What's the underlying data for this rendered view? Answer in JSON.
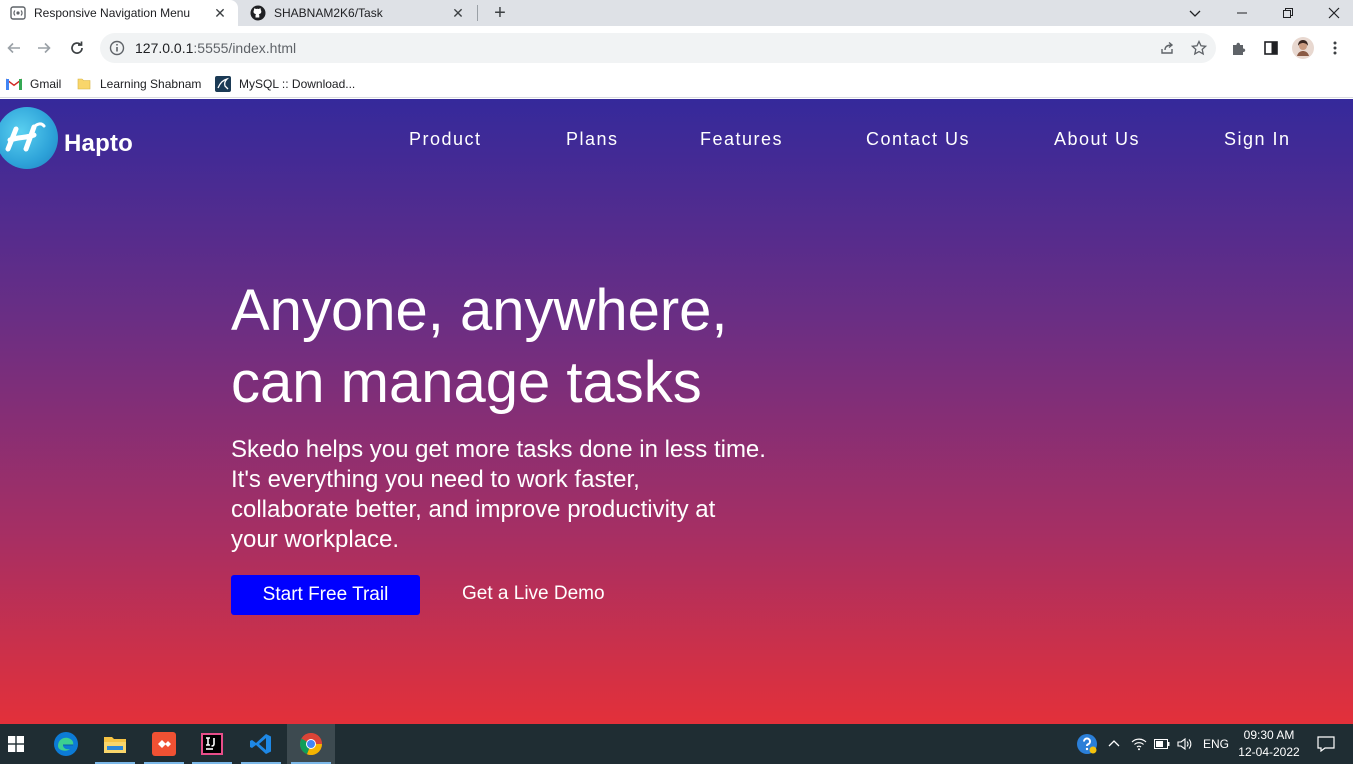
{
  "browser": {
    "tabs": [
      {
        "title": "Responsive Navigation Menu",
        "favicon": "broadcast-icon",
        "active": true
      },
      {
        "title": "SHABNAM2K6/Task",
        "favicon": "github-icon",
        "active": false
      }
    ],
    "address": {
      "host": "127.0.0.1",
      "rest": ":5555/index.html"
    },
    "bookmarks": [
      {
        "label": "Gmail",
        "icon": "gmail-icon"
      },
      {
        "label": "Learning Shabnam",
        "icon": "folder-icon"
      },
      {
        "label": "MySQL :: Download...",
        "icon": "mysql-icon"
      }
    ]
  },
  "site": {
    "brand": "Hapto",
    "nav": [
      "Product",
      "Plans",
      "Features",
      "Contact Us",
      "About Us",
      "Sign In"
    ],
    "hero": {
      "title_line1": "Anyone, anywhere,",
      "title_line2": "can manage tasks",
      "subtitle_line1": "Skedo helps you get more tasks done in less time.",
      "subtitle_line2": "It's everything you need to work faster,",
      "subtitle_line3": "collaborate better, and improve productivity at",
      "subtitle_line4": "your workplace.",
      "primary_cta": "Start Free Trail",
      "secondary_cta": "Get a Live Demo"
    },
    "colors": {
      "gradient_top": "#35299b",
      "gradient_bottom": "#e3303a",
      "cta": "#0000ff"
    }
  },
  "taskbar": {
    "language": "ENG",
    "time": "09:30 AM",
    "date": "12-04-2022"
  }
}
